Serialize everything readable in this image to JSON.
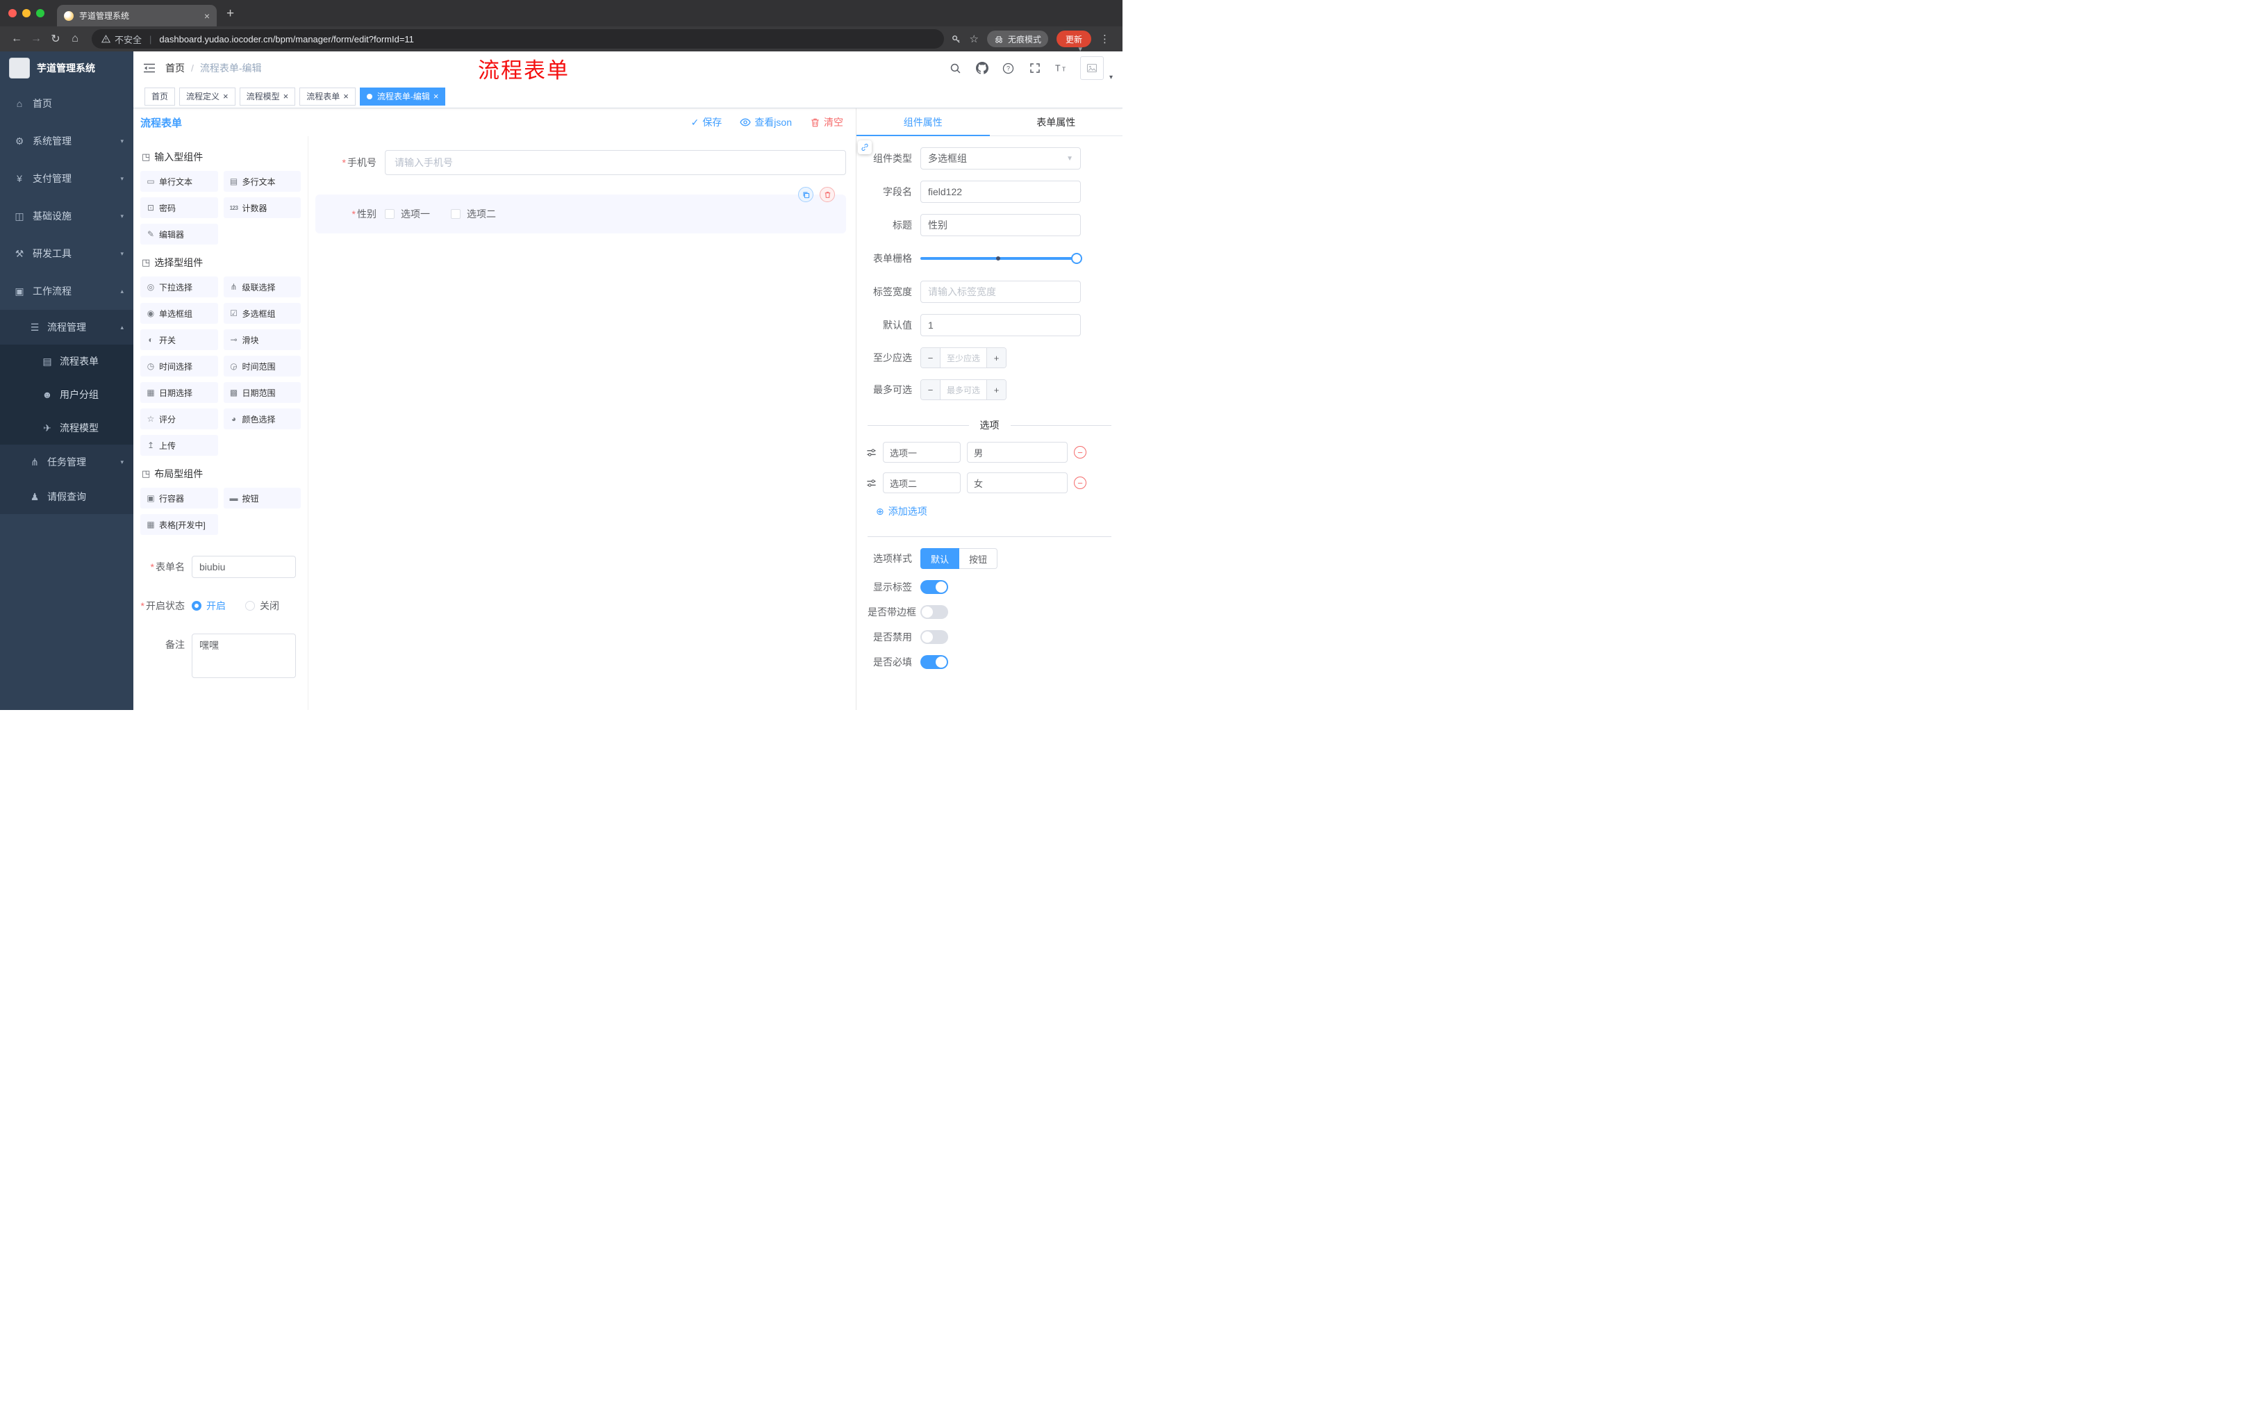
{
  "colors": {
    "primary": "#409eff",
    "danger": "#f56c6c",
    "sidebar_bg": "#304156"
  },
  "browser": {
    "tab_title": "芋道管理系统",
    "security_text": "不安全",
    "url": "dashboard.yudao.iocoder.cn/bpm/manager/form/edit?formId=11",
    "incognito_label": "无痕模式",
    "update_label": "更新"
  },
  "annotation_text": "流程表单",
  "sidebar": {
    "title": "芋道管理系统",
    "items": [
      {
        "label": "首页"
      },
      {
        "label": "系统管理"
      },
      {
        "label": "支付管理"
      },
      {
        "label": "基础设施"
      },
      {
        "label": "研发工具"
      },
      {
        "label": "工作流程"
      }
    ],
    "sub_items": {
      "process_mgmt": "流程管理",
      "process_form": "流程表单",
      "user_group": "用户分组",
      "process_model": "流程模型",
      "task_mgmt": "任务管理",
      "leave_query": "请假查询"
    }
  },
  "header": {
    "breadcrumb_home": "首页",
    "breadcrumb_current": "流程表单-编辑"
  },
  "tags": [
    {
      "label": "首页"
    },
    {
      "label": "流程定义"
    },
    {
      "label": "流程模型"
    },
    {
      "label": "流程表单"
    },
    {
      "label": "流程表单-编辑"
    }
  ],
  "designer": {
    "title": "流程表单",
    "save_label": "保存",
    "view_json_label": "查看json",
    "clear_label": "清空",
    "groups": [
      {
        "title": "输入型组件",
        "items": [
          "单行文本",
          "多行文本",
          "密码",
          "计数器",
          "编辑器"
        ]
      },
      {
        "title": "选择型组件",
        "items": [
          "下拉选择",
          "级联选择",
          "单选框组",
          "多选框组",
          "开关",
          "滑块",
          "时间选择",
          "时间范围",
          "日期选择",
          "日期范围",
          "评分",
          "颜色选择",
          "上传"
        ]
      },
      {
        "title": "布局型组件",
        "items": [
          "行容器",
          "按钮",
          "表格[开发中]"
        ]
      }
    ],
    "meta": {
      "form_name_label": "表单名",
      "form_name_value": "biubiu",
      "status_label": "开启状态",
      "status_on": "开启",
      "status_off": "关闭",
      "remark_label": "备注",
      "remark_value": "嘿嘿"
    },
    "canvas": {
      "phone_label": "手机号",
      "phone_placeholder": "请输入手机号",
      "gender_label": "性别",
      "gender_opt1": "选项一",
      "gender_opt2": "选项二"
    }
  },
  "props": {
    "tab_component": "组件属性",
    "tab_form": "表单属性",
    "component_type_label": "组件类型",
    "component_type_value": "多选框组",
    "field_name_label": "字段名",
    "field_name_value": "field122",
    "title_label": "标题",
    "title_value": "性别",
    "grid_label": "表单栅格",
    "label_width_label": "标签宽度",
    "label_width_placeholder": "请输入标签宽度",
    "default_label": "默认值",
    "default_value": "1",
    "min_label": "至少应选",
    "min_placeholder": "至少应选",
    "max_label": "最多可选",
    "max_placeholder": "最多可选",
    "options_title": "选项",
    "options": [
      {
        "name": "选项一",
        "value": "男"
      },
      {
        "name": "选项二",
        "value": "女"
      }
    ],
    "add_option_label": "添加选项",
    "style_label": "选项样式",
    "style_default": "默认",
    "style_button": "按钮",
    "switch_show_label": "显示标签",
    "switch_border": "是否带边框",
    "switch_disabled": "是否禁用",
    "switch_required": "是否必填"
  }
}
